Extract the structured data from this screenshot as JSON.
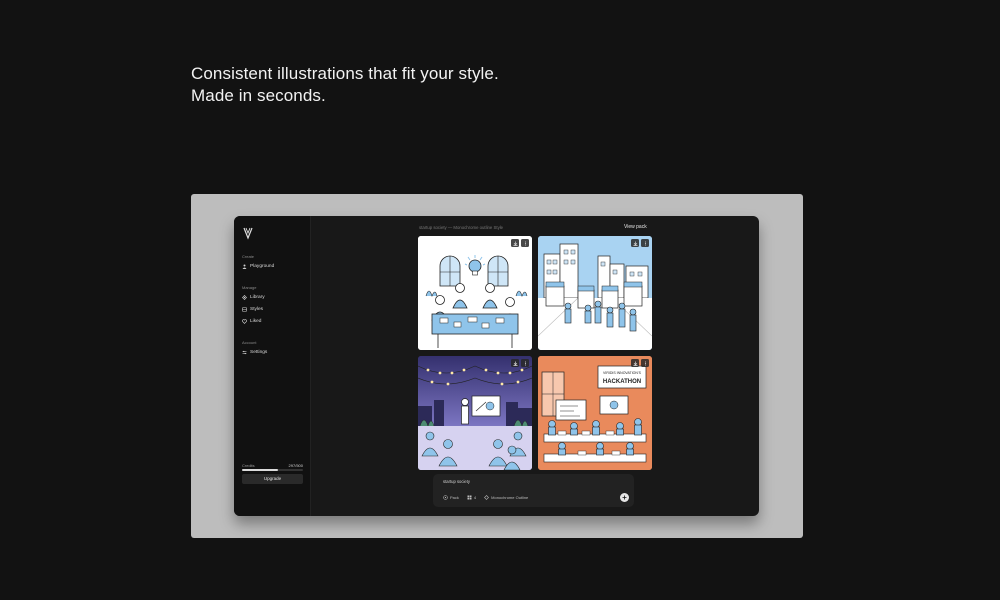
{
  "headline": {
    "line1": "Consistent illustrations that fit your style.",
    "line2": "Made in seconds."
  },
  "sidebar": {
    "sections": {
      "create": "Create",
      "manage": "Manage",
      "account": "Account"
    },
    "items": [
      {
        "label": "Playground",
        "icon": "user-icon"
      },
      {
        "label": "Library",
        "icon": "library-icon"
      },
      {
        "label": "Styles",
        "icon": "styles-icon"
      },
      {
        "label": "Liked",
        "icon": "heart-icon"
      },
      {
        "label": "Settings",
        "icon": "sliders-icon"
      }
    ],
    "credits": {
      "label": "Credits",
      "count": "297/500",
      "fraction": 0.59
    },
    "upgrade_label": "Upgrade"
  },
  "main": {
    "breadcrumb": "startup society — Monochrome outline Style",
    "view_pack_label": "View pack",
    "images": [
      {
        "name": "team-workshop-illustration",
        "banner": ""
      },
      {
        "name": "street-fair-illustration",
        "banner": ""
      },
      {
        "name": "rooftop-presentation-illustration",
        "banner": ""
      },
      {
        "name": "hackathon-illustration",
        "banner": "HACKATHON"
      }
    ]
  },
  "prompt": {
    "text": "startup society",
    "chips": {
      "pack": "Pack",
      "count": "4",
      "style": "Monochrome Outline"
    }
  },
  "colors": {
    "page_bg": "#121212",
    "frame_bg": "#bdbdbd",
    "app_bg": "#181818",
    "sidebar_bg": "#111111",
    "illustration_blue": "#8fc4ea",
    "illustration_orange": "#e98a5c",
    "illustration_navy": "#3d3a78"
  }
}
